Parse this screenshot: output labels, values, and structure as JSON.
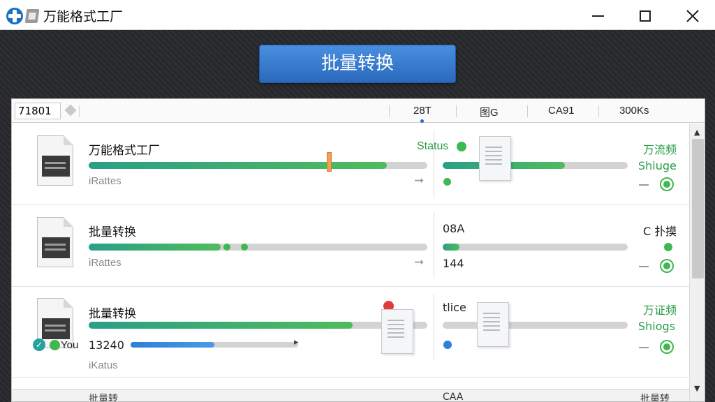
{
  "window": {
    "title": "万能格式工厂",
    "buttons": [
      "minimize",
      "maximize",
      "close"
    ]
  },
  "toolbar": {
    "batch_label": "批量转换"
  },
  "header": {
    "input_value": "71801",
    "col1": "28T",
    "col2": "图G",
    "col3": "CA91",
    "col4": "300Ks"
  },
  "rows": [
    {
      "name": "万能格式工厂",
      "sub_label": "iRattes",
      "status": "Status",
      "right_top": "万流频",
      "right_mid": "Shiuge",
      "progress_left": 0.88,
      "progress_right": 0.66
    },
    {
      "name": "批量转换",
      "sub_label": "iRattes",
      "mid_top": "08A",
      "mid_sub": "144",
      "right_top": "C 扑摸",
      "progress_left": 0.39,
      "progress_right": 0.09
    },
    {
      "name": "批量转换",
      "sub_label": "iKatus",
      "size_value": "13240",
      "badge_text": "You",
      "mid_top": "tlice",
      "right_top": "万证频",
      "right_mid": "Shiogs",
      "progress_left": 0.78,
      "progress_blue": 0.5
    }
  ],
  "partial_row": {
    "name": "批量转",
    "mid": "CAA",
    "right": "批量转"
  },
  "colors": {
    "accent_blue": "#2a69bd",
    "progress_green": "#3fb84f",
    "status_green": "#2a9a46",
    "alert_red": "#e23b3b",
    "handle_orange": "#f0a050"
  },
  "icons": [
    "app-logo-icon",
    "file-icon",
    "doc-icon",
    "arrow-right-icon",
    "check-icon",
    "scroll-up-icon",
    "scroll-down-icon",
    "close-icon"
  ]
}
